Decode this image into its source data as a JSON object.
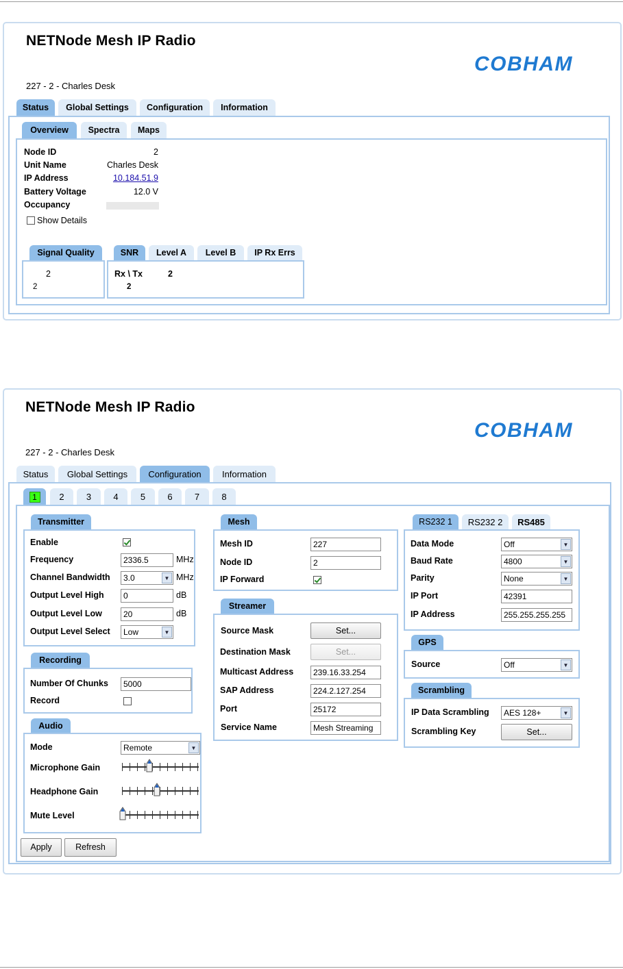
{
  "colors": {
    "tab_selected": "#90bde8",
    "tab_normal": "#e0ecf8",
    "border": "#a9c9ea",
    "logo": "#1f7ad1",
    "active_channel": "#39ff14"
  },
  "top": {
    "app_title": "NETNode Mesh IP Radio",
    "logo_text": "COBHAM",
    "node_line": "227 - 2 - Charles Desk",
    "main_tabs": [
      {
        "label": "Status",
        "selected": true
      },
      {
        "label": "Global Settings"
      },
      {
        "label": "Configuration"
      },
      {
        "label": "Information"
      }
    ],
    "sub_tabs": [
      {
        "label": "Overview",
        "selected": true
      },
      {
        "label": "Spectra"
      },
      {
        "label": "Maps"
      }
    ],
    "overview": {
      "node_id_label": "Node ID",
      "node_id_value": "2",
      "unit_name_label": "Unit Name",
      "unit_name_value": "Charles Desk",
      "ip_address_label": "IP Address",
      "ip_address_value": "10.184.51.9",
      "battery_label": "Battery Voltage",
      "battery_value": "12.0 V",
      "occupancy_label": "Occupancy",
      "occupancy_level": 0,
      "show_details_label": "Show Details",
      "show_details_checked": false
    },
    "signal_quality": {
      "tab": "Signal Quality",
      "col_value": "2",
      "row_value": "2"
    },
    "snr_tabs": [
      {
        "label": "SNR",
        "selected": true
      },
      {
        "label": "Level A"
      },
      {
        "label": "Level B"
      },
      {
        "label": "IP Rx Errs"
      }
    ],
    "snr": {
      "header": "Rx \\ Tx",
      "col_value": "2",
      "row_value": "2"
    }
  },
  "bottom": {
    "app_title": "NETNode Mesh IP Radio",
    "logo_text": "COBHAM",
    "node_line": "227 - 2 - Charles Desk",
    "main_tabs": [
      {
        "label": "Status"
      },
      {
        "label": "Global Settings"
      },
      {
        "label": "Configuration",
        "selected": true
      },
      {
        "label": "Information"
      }
    ],
    "channel_tabs": [
      "1",
      "2",
      "3",
      "4",
      "5",
      "6",
      "7",
      "8"
    ],
    "active_channel": "1",
    "transmitter": {
      "title": "Transmitter",
      "enable_label": "Enable",
      "enable_checked": true,
      "frequency_label": "Frequency",
      "frequency_value": "2336.5",
      "frequency_unit": "MHz",
      "bandwidth_label": "Channel Bandwidth",
      "bandwidth_value": "3.0",
      "bandwidth_unit": "MHz",
      "out_high_label": "Output Level High",
      "out_high_value": "0",
      "out_high_unit": "dB",
      "out_low_label": "Output Level Low",
      "out_low_value": "20",
      "out_low_unit": "dB",
      "out_select_label": "Output Level Select",
      "out_select_value": "Low"
    },
    "recording": {
      "title": "Recording",
      "chunks_label": "Number Of Chunks",
      "chunks_value": "5000",
      "record_label": "Record",
      "record_checked": false
    },
    "audio": {
      "title": "Audio",
      "mode_label": "Mode",
      "mode_value": "Remote",
      "mic_label": "Microphone Gain",
      "mic_level": 0.35,
      "headphone_label": "Headphone Gain",
      "headphone_level": 0.45,
      "mute_label": "Mute Level",
      "mute_level": 0.0
    },
    "mesh": {
      "title": "Mesh",
      "mesh_id_label": "Mesh ID",
      "mesh_id_value": "227",
      "node_id_label": "Node ID",
      "node_id_value": "2",
      "ip_forward_label": "IP Forward",
      "ip_forward_checked": true
    },
    "streamer": {
      "title": "Streamer",
      "source_mask_label": "Source Mask",
      "source_mask_button": "Set...",
      "dest_mask_label": "Destination Mask",
      "dest_mask_button": "Set...",
      "multicast_label": "Multicast Address",
      "multicast_value": "239.16.33.254",
      "sap_label": "SAP Address",
      "sap_value": "224.2.127.254",
      "port_label": "Port",
      "port_value": "25172",
      "service_label": "Service Name",
      "service_value": "Mesh Streaming"
    },
    "serial_tabs": [
      {
        "label": "RS232 1",
        "selected": true
      },
      {
        "label": "RS232 2"
      },
      {
        "label": "RS485"
      }
    ],
    "serial": {
      "data_mode_label": "Data Mode",
      "data_mode_value": "Off",
      "baud_label": "Baud Rate",
      "baud_value": "4800",
      "parity_label": "Parity",
      "parity_value": "None",
      "ip_port_label": "IP Port",
      "ip_port_value": "42391",
      "ip_address_label": "IP Address",
      "ip_address_value": "255.255.255.255"
    },
    "gps": {
      "title": "GPS",
      "source_label": "Source",
      "source_value": "Off"
    },
    "scrambling": {
      "title": "Scrambling",
      "ip_data_label": "IP Data Scrambling",
      "ip_data_value": "AES 128+",
      "key_label": "Scrambling Key",
      "key_button": "Set..."
    },
    "apply_button": "Apply",
    "refresh_button": "Refresh"
  }
}
